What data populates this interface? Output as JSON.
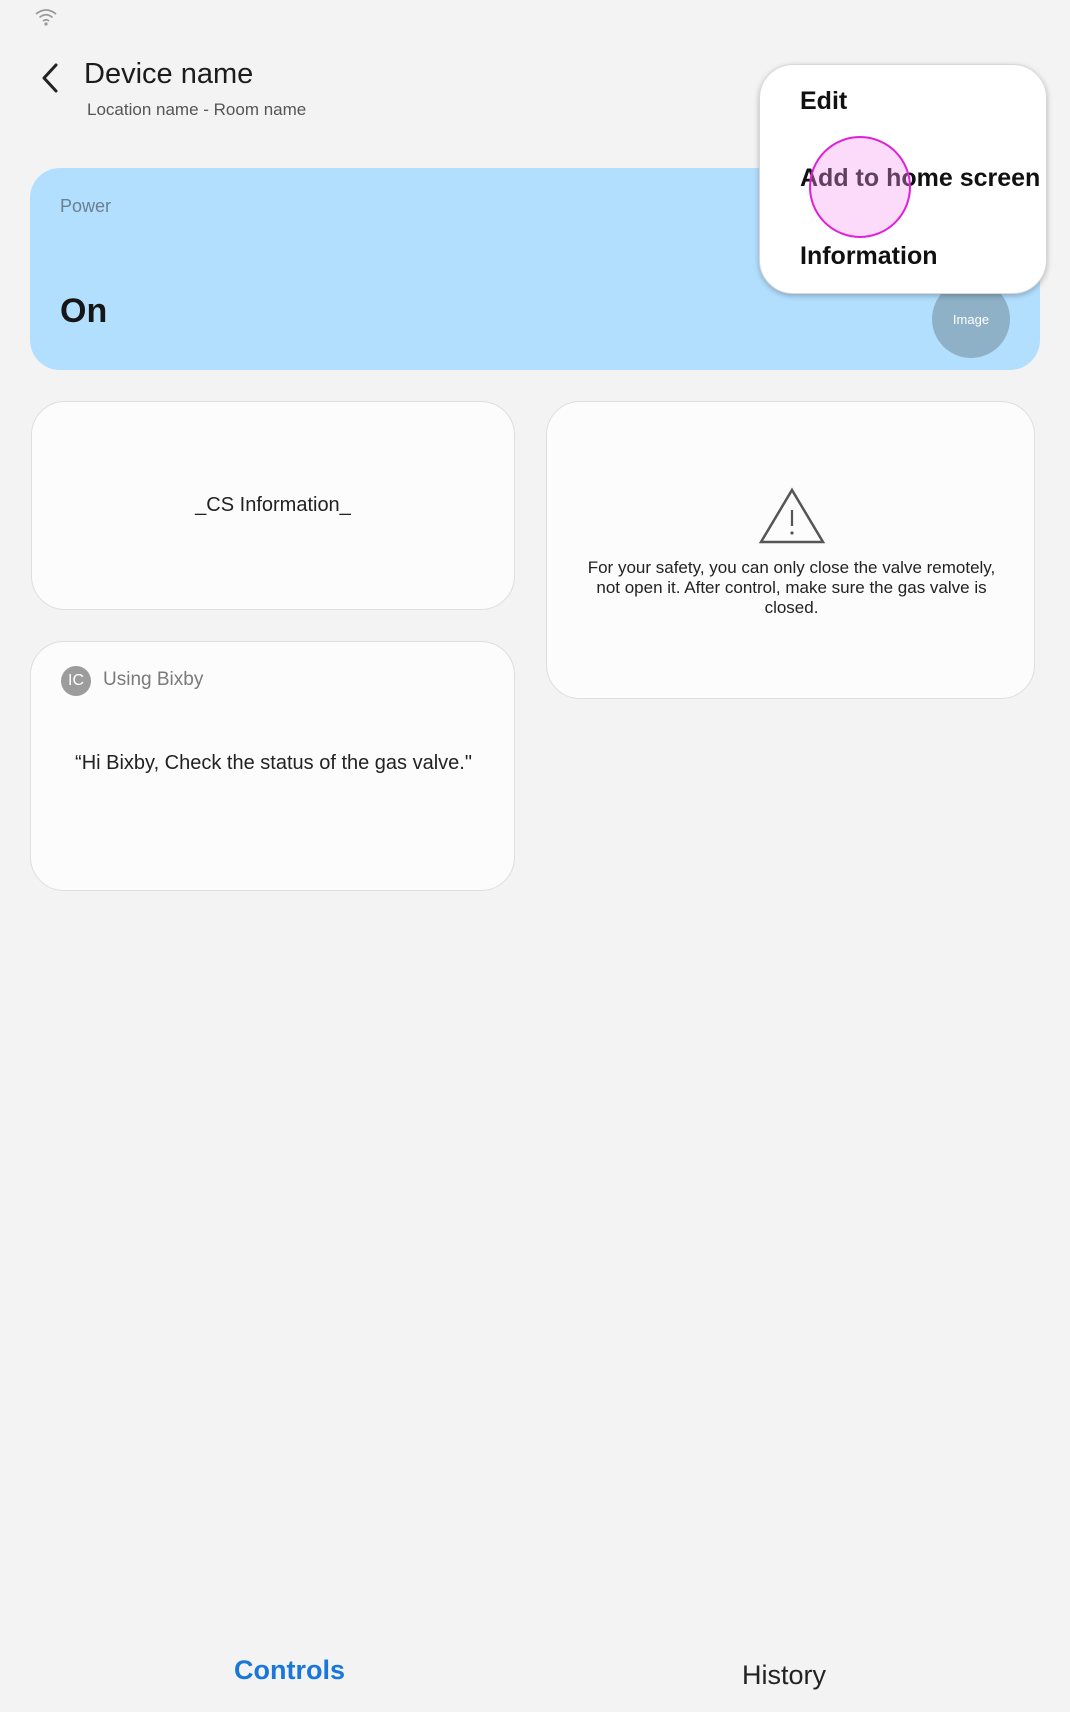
{
  "status_bar": {
    "wifi_icon": "wifi-icon"
  },
  "header": {
    "back_icon": "chevron-left-icon",
    "title": "Device name",
    "subtitle": "Location name - Room name"
  },
  "power_card": {
    "label": "Power",
    "value": "On",
    "image_label": "Image",
    "background_color": "#b3dfff"
  },
  "cs_card": {
    "text": "_CS Information_"
  },
  "safety_card": {
    "icon": "warning-triangle-icon",
    "text": "For your safety, you can only close the valve remotely, not open it. After control, make sure the gas valve is closed."
  },
  "bixby_card": {
    "icon_text": "IC",
    "title": "Using Bixby",
    "quote": "“Hi Bixby, Check the status of the gas valve.\""
  },
  "popup_menu": {
    "items": [
      {
        "label": "Edit"
      },
      {
        "label": "Add to home screen"
      },
      {
        "label": "Information"
      }
    ]
  },
  "bottom_tabs": {
    "controls": "Controls",
    "history": "History",
    "active_color": "#1a77d8"
  }
}
